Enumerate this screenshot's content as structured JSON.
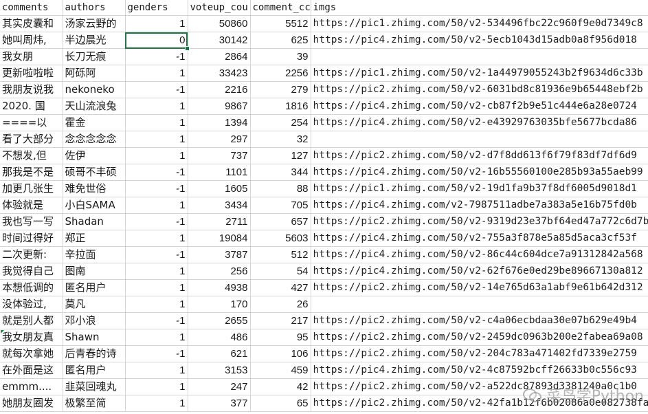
{
  "sheet": {
    "headers": [
      "comments",
      "authors",
      "genders",
      "voteup_cou",
      "comment_cc",
      "imgs"
    ],
    "rows": [
      {
        "comments": "其实皮囊和",
        "authors": "汤家云野的",
        "genders": "1",
        "voteup": "50860",
        "comment": "5512",
        "imgs": "https://pic1.zhimg.com/50/v2-534496fbc22c960f9e0d7349c8"
      },
      {
        "comments": "她叫周炜,",
        "authors": "半边晨光",
        "genders": "0",
        "voteup": "30142",
        "comment": "625",
        "imgs": "https://pic4.zhimg.com/50/v2-5ecb1043d15adb0a8f956d018"
      },
      {
        "comments": "我女朋",
        "authors": "长刀无痕",
        "genders": "-1",
        "voteup": "2864",
        "comment": "39",
        "imgs": ""
      },
      {
        "comments": "更新啦啦啦",
        "authors": "阿砾阿",
        "genders": "1",
        "voteup": "33423",
        "comment": "2256",
        "imgs": "https://pic1.zhimg.com/50/v2-1a44979055243b2f9634d6c33b"
      },
      {
        "comments": "我朋友说我",
        "authors": "nekoneko",
        "genders": "-1",
        "voteup": "2216",
        "comment": "279",
        "imgs": "https://pic2.zhimg.com/50/v2-6031bd8c81936e9b65448ebf2b"
      },
      {
        "comments": "2020.  国",
        "authors": "天山流浪兔",
        "genders": "1",
        "voteup": "9867",
        "comment": "1816",
        "imgs": "https://pic4.zhimg.com/50/v2-cb87f2b9e51c444e6a28e0724"
      },
      {
        "comments": "====以",
        "authors": "霍金",
        "genders": "1",
        "voteup": "1394",
        "comment": "254",
        "imgs": "https://pic4.zhimg.com/50/v2-e43929763035bfe5677bcda86"
      },
      {
        "comments": "看了大部分",
        "authors": "念念念念念",
        "genders": "1",
        "voteup": "297",
        "comment": "32",
        "imgs": ""
      },
      {
        "comments": "不想发,但",
        "authors": "佐伊",
        "genders": "1",
        "voteup": "737",
        "comment": "127",
        "imgs": "https://pic2.zhimg.com/50/v2-d7f8dd613f6f79f83df7df6d9"
      },
      {
        "comments": "那我是不是",
        "authors": "硕哥不丰硕",
        "genders": "-1",
        "voteup": "1101",
        "comment": "344",
        "imgs": "https://pic4.zhimg.com/50/v2-16b55560100e285b93a55aeb99"
      },
      {
        "comments": "加更几张生",
        "authors": "难免世俗",
        "genders": "-1",
        "voteup": "1605",
        "comment": "88",
        "imgs": "https://pic1.zhimg.com/50/v2-19d1fa9b37f8df6005d9018d1"
      },
      {
        "comments": "体验就是",
        "authors": "小白SAMA",
        "genders": "1",
        "voteup": "3434",
        "comment": "705",
        "imgs": "https://pic4.zhimg.com/v2-7987511adbe7a383a5e16b75fd0b"
      },
      {
        "comments": "我也写一写",
        "authors": "Shadan",
        "genders": "-1",
        "voteup": "2711",
        "comment": "657",
        "imgs": "https://pic2.zhimg.com/50/v2-9319d23e37bf64ed47a772c6d7b0"
      },
      {
        "comments": "时间过得好",
        "authors": "郑正",
        "genders": "1",
        "voteup": "19084",
        "comment": "5603",
        "imgs": "https://pic4.zhimg.com/50/v2-755a3f878e5a85d5aca3cf53f"
      },
      {
        "comments": "二次更新:",
        "authors": "辛拉面",
        "genders": "-1",
        "voteup": "3787",
        "comment": "512",
        "imgs": "https://pic4.zhimg.com/50/v2-86c44c604dce7a91312842a568"
      },
      {
        "comments": "我觉得自己",
        "authors": "图南",
        "genders": "1",
        "voteup": "256",
        "comment": "54",
        "imgs": "https://pic4.zhimg.com/50/v2-62f676e0ed29be89667130a812"
      },
      {
        "comments": "本想低调的",
        "authors": "匿名用户",
        "genders": "1",
        "voteup": "4938",
        "comment": "427",
        "imgs": "https://pic2.zhimg.com/50/v2-14e765d63a1abf9e61b642d312"
      },
      {
        "comments": "没体验过,",
        "authors": "莫凡",
        "genders": "1",
        "voteup": "170",
        "comment": "26",
        "imgs": ""
      },
      {
        "comments": "就是别人都",
        "authors": "邓小浪",
        "genders": "-1",
        "voteup": "2655",
        "comment": "217",
        "imgs": "https://pic2.zhimg.com/50/v2-c4a06ecbdaa30e07b629e49b4"
      },
      {
        "comments": "我女朋友真",
        "authors": "Shawn",
        "genders": "1",
        "voteup": "486",
        "comment": "95",
        "imgs": "https://pic2.zhimg.com/50/v2-2459dc0963b200e2fabea69a08"
      },
      {
        "comments": "就每次拿她",
        "authors": "后青春的诗",
        "genders": "-1",
        "voteup": "621",
        "comment": "106",
        "imgs": "https://pic2.zhimg.com/50/v2-204c783a471402fd7339e2759"
      },
      {
        "comments": "在外面是这",
        "authors": "匿名用户",
        "genders": "1",
        "voteup": "3153",
        "comment": "459",
        "imgs": "https://pic4.zhimg.com/50/v2-4c87592bcff26633b0c556c93"
      },
      {
        "comments": "emmm....",
        "authors": "韭菜回魂丸",
        "genders": "1",
        "voteup": "247",
        "comment": "42",
        "imgs": "https://pic2.zhimg.com/50/v2-a522dc87893d3381240a0c1b0"
      },
      {
        "comments": "她朋友圈发",
        "authors": "极繁至简",
        "genders": "1",
        "voteup": "377",
        "comment": "65",
        "imgs": "https://pic2.zhimg.com/50/v2-42fa1b12f6b02086a0e082738faa"
      }
    ]
  },
  "selection": {
    "row": 1,
    "column": "genders"
  },
  "watermark": {
    "text": "菜鸟学Python",
    "icon": "wechat-icon"
  },
  "colors": {
    "grid_line": "#d4d4d4",
    "selection": "#217346",
    "indicator": "#1e8a3a"
  }
}
